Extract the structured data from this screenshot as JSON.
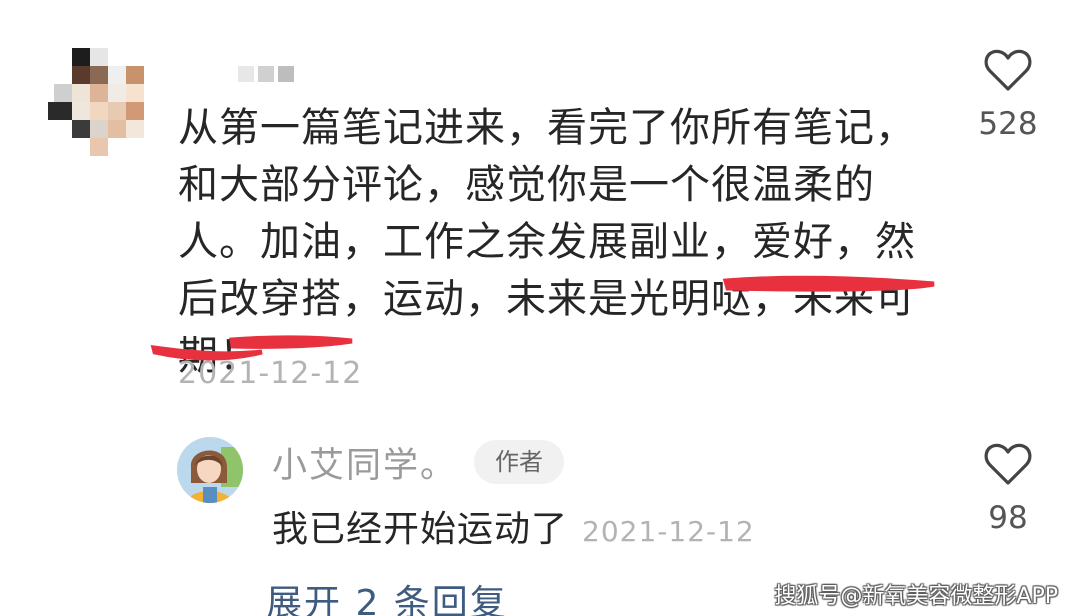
{
  "comment": {
    "text": "从第一篇笔记进来，看完了你所有笔记，和大部分评论，感觉你是一个很温柔的人。加油，工作之余发展副业，爱好，然后改穿搭，运动，未来是光明哒，未来可期！",
    "date": "2021-12-12",
    "likes": "528",
    "highlight_color": "#e8313f"
  },
  "reply": {
    "username": "小艾同学。",
    "author_badge": "作者",
    "text": "我已经开始运动了",
    "date": "2021-12-12",
    "likes": "98"
  },
  "expand_replies": "展开 2 条回复",
  "watermark": "搜狐号@新氧美容微整形APP",
  "icons": {
    "like": "heart-outline-icon"
  }
}
